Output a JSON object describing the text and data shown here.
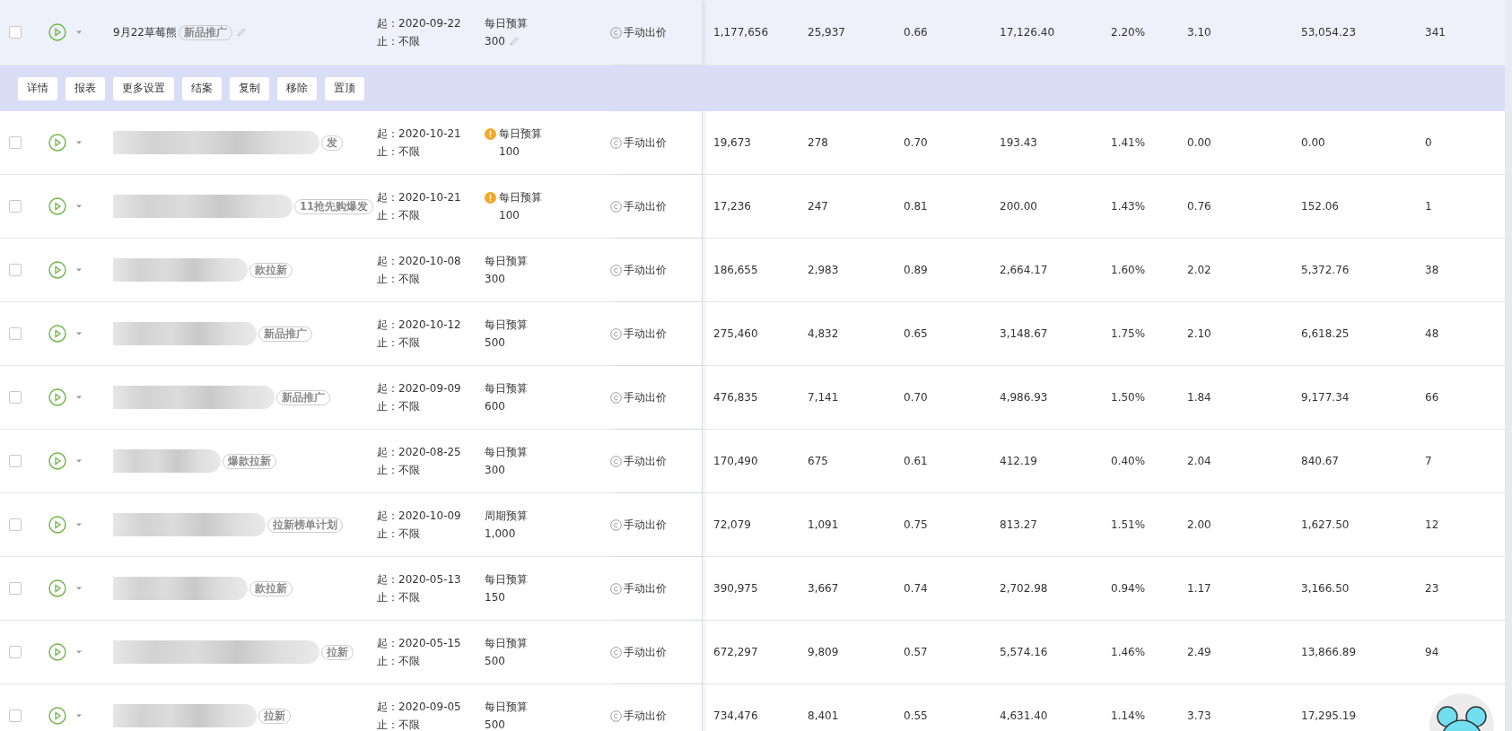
{
  "actions": [
    "详情",
    "报表",
    "更多设置",
    "结案",
    "复制",
    "移除",
    "置顶"
  ],
  "rows": [
    {
      "expanded": true,
      "checked": false,
      "blurred": false,
      "name": "9月22草莓熊",
      "tag": "新品推广",
      "start": "起：2020-09-22",
      "end": "止：不限",
      "warning": false,
      "budget_label": "每日预算",
      "budget": "300",
      "budget_editable": true,
      "bid": "手动出价",
      "metrics": [
        "1,177,656",
        "25,937",
        "0.66",
        "17,126.40",
        "2.20%",
        "3.10",
        "53,054.23",
        "341"
      ]
    },
    {
      "expanded": false,
      "checked": false,
      "blurred": true,
      "tag": "发",
      "start": "起：2020-10-21",
      "end": "止：不限",
      "warning": true,
      "budget_label": "每日预算",
      "budget": "100",
      "budget_editable": false,
      "bid": "手动出价",
      "metrics": [
        "19,673",
        "278",
        "0.70",
        "193.43",
        "1.41%",
        "0.00",
        "0.00",
        "0"
      ]
    },
    {
      "expanded": false,
      "checked": false,
      "blurred": true,
      "tag": "11抢先购爆发",
      "start": "起：2020-10-21",
      "end": "止：不限",
      "warning": true,
      "budget_label": "每日预算",
      "budget": "100",
      "budget_editable": false,
      "bid": "手动出价",
      "metrics": [
        "17,236",
        "247",
        "0.81",
        "200.00",
        "1.43%",
        "0.76",
        "152.06",
        "1"
      ]
    },
    {
      "expanded": false,
      "checked": false,
      "blurred": true,
      "tag": "款拉新",
      "start": "起：2020-10-08",
      "end": "止：不限",
      "warning": false,
      "budget_label": "每日预算",
      "budget": "300",
      "budget_editable": false,
      "bid": "手动出价",
      "metrics": [
        "186,655",
        "2,983",
        "0.89",
        "2,664.17",
        "1.60%",
        "2.02",
        "5,372.76",
        "38"
      ]
    },
    {
      "expanded": false,
      "checked": false,
      "blurred": true,
      "tag": "新品推广",
      "start": "起：2020-10-12",
      "end": "止：不限",
      "warning": false,
      "budget_label": "每日预算",
      "budget": "500",
      "budget_editable": false,
      "bid": "手动出价",
      "metrics": [
        "275,460",
        "4,832",
        "0.65",
        "3,148.67",
        "1.75%",
        "2.10",
        "6,618.25",
        "48"
      ]
    },
    {
      "expanded": false,
      "checked": false,
      "blurred": true,
      "tag": "新品推广",
      "start": "起：2020-09-09",
      "end": "止：不限",
      "warning": false,
      "budget_label": "每日预算",
      "budget": "600",
      "budget_editable": false,
      "bid": "手动出价",
      "metrics": [
        "476,835",
        "7,141",
        "0.70",
        "4,986.93",
        "1.50%",
        "1.84",
        "9,177.34",
        "66"
      ]
    },
    {
      "expanded": false,
      "checked": false,
      "blurred": true,
      "tag": "爆款拉新",
      "start": "起：2020-08-25",
      "end": "止：不限",
      "warning": false,
      "budget_label": "每日预算",
      "budget": "300",
      "budget_editable": false,
      "bid": "手动出价",
      "metrics": [
        "170,490",
        "675",
        "0.61",
        "412.19",
        "0.40%",
        "2.04",
        "840.67",
        "7"
      ]
    },
    {
      "expanded": false,
      "checked": false,
      "blurred": true,
      "tag": "拉新榜单计划",
      "start": "起：2020-10-09",
      "end": "止：不限",
      "warning": false,
      "budget_label": "周期预算",
      "budget": "1,000",
      "budget_editable": false,
      "bid": "手动出价",
      "metrics": [
        "72,079",
        "1,091",
        "0.75",
        "813.27",
        "1.51%",
        "2.00",
        "1,627.50",
        "12"
      ]
    },
    {
      "expanded": false,
      "checked": false,
      "blurred": true,
      "tag": "款拉新",
      "start": "起：2020-05-13",
      "end": "止：不限",
      "warning": false,
      "budget_label": "每日预算",
      "budget": "150",
      "budget_editable": false,
      "bid": "手动出价",
      "metrics": [
        "390,975",
        "3,667",
        "0.74",
        "2,702.98",
        "0.94%",
        "1.17",
        "3,166.50",
        "23"
      ]
    },
    {
      "expanded": false,
      "checked": false,
      "blurred": true,
      "tag": "拉新",
      "start": "起：2020-05-15",
      "end": "止：不限",
      "warning": false,
      "budget_label": "每日预算",
      "budget": "500",
      "budget_editable": false,
      "bid": "手动出价",
      "metrics": [
        "672,297",
        "9,809",
        "0.57",
        "5,574.16",
        "1.46%",
        "2.49",
        "13,866.89",
        "94"
      ]
    },
    {
      "expanded": false,
      "checked": false,
      "blurred": true,
      "tag": "拉新",
      "start": "起：2020-09-05",
      "end": "止：不限",
      "warning": false,
      "budget_label": "每日预算",
      "budget": "500",
      "budget_editable": false,
      "bid": "手动出价",
      "metrics": [
        "734,476",
        "8,401",
        "0.55",
        "4,631.40",
        "1.14%",
        "3.73",
        "17,295.19"
      ]
    }
  ]
}
